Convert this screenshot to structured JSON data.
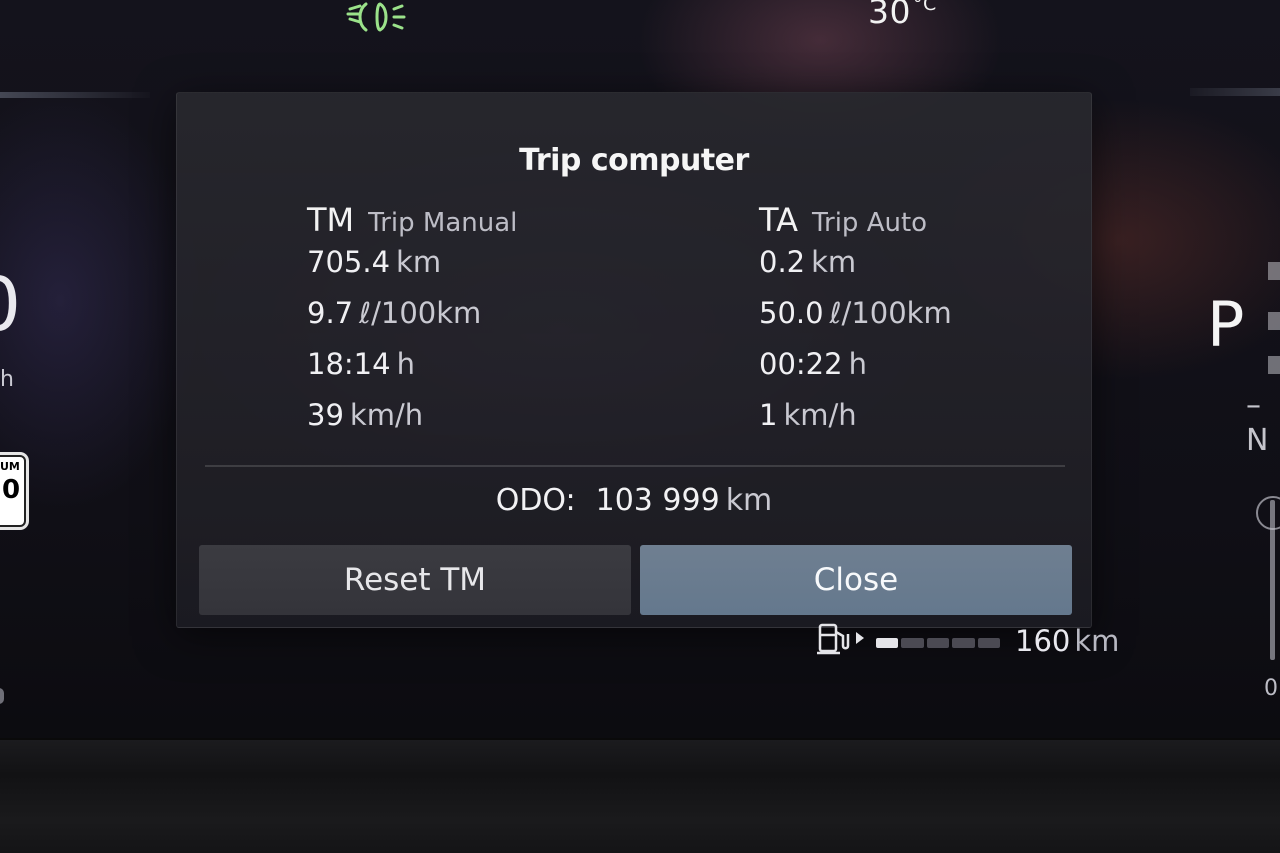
{
  "status": {
    "headlight_icon": "low-beam-headlight-icon",
    "headlight_color": "#9be28a",
    "temperature_value": "30",
    "temperature_unit": "°C"
  },
  "left_cluster": {
    "speed_digit": "0",
    "speed_unit": "h",
    "sign_header": "UM",
    "sign_value": "0"
  },
  "right_cluster": {
    "gear_selected": "P",
    "gear_hint": "–N",
    "needle_zero": "0"
  },
  "dialog": {
    "title": "Trip computer",
    "trip_manual": {
      "abbr": "TM",
      "name": "Trip Manual",
      "distance_value": "705.4",
      "distance_unit": "km",
      "consumption_value": "9.7",
      "consumption_unit": "ℓ/100km",
      "time_value": "18:14",
      "time_unit": "h",
      "speed_value": "39",
      "speed_unit": "km/h"
    },
    "trip_auto": {
      "abbr": "TA",
      "name": "Trip Auto",
      "distance_value": "0.2",
      "distance_unit": "km",
      "consumption_value": "50.0",
      "consumption_unit": "ℓ/100km",
      "time_value": "00:22",
      "time_unit": "h",
      "speed_value": "1",
      "speed_unit": "km/h"
    },
    "odo": {
      "label": "ODO:",
      "value": "103 999",
      "unit": "km"
    },
    "buttons": {
      "reset_label": "Reset TM",
      "close_label": "Close"
    }
  },
  "fuel": {
    "icon": "fuel-pump-icon",
    "level_fraction": 0.2,
    "segments": 5,
    "range_value": "160",
    "range_unit": "km"
  }
}
